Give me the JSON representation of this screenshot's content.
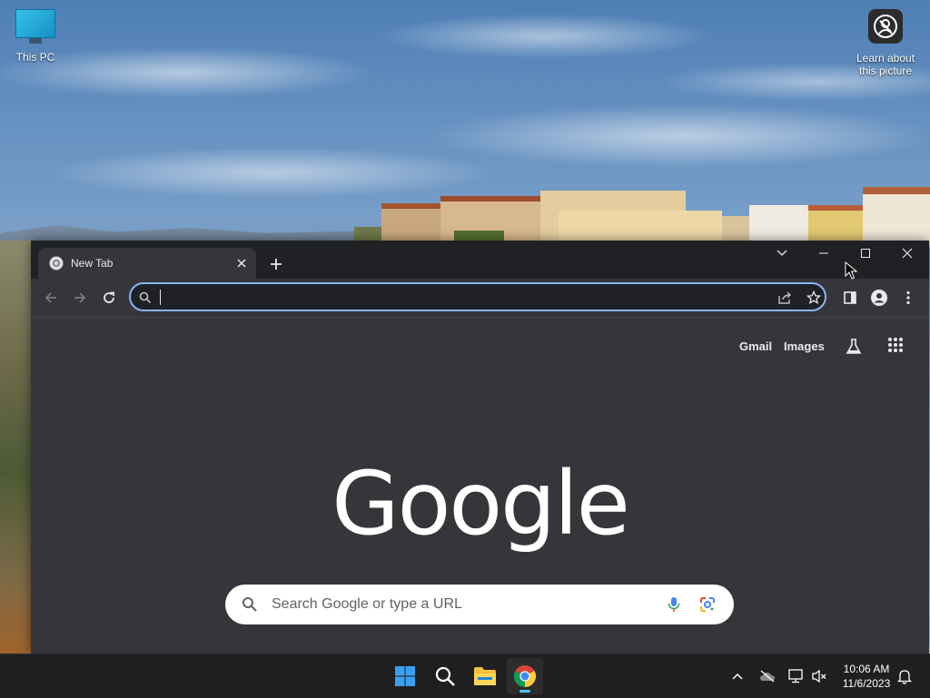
{
  "desktop": {
    "icons": [
      {
        "label": "This PC",
        "icon": "monitor-icon"
      },
      {
        "label": "Learn about this picture",
        "icon": "camera-info-icon"
      }
    ]
  },
  "browser": {
    "tab": {
      "title": "New Tab",
      "favicon": "chrome-icon"
    },
    "window_controls": {
      "dropdown": "chevron-down-icon",
      "minimize": "minimize-icon",
      "maximize": "maximize-icon",
      "close": "close-icon"
    },
    "omnibox": {
      "value": "",
      "placeholder": ""
    },
    "toolbar_icons": [
      "back-arrow-icon",
      "forward-arrow-icon",
      "reload-icon",
      "share-icon",
      "star-icon",
      "side-panel-icon",
      "profile-icon",
      "more-vert-icon"
    ]
  },
  "newtab_page": {
    "links": {
      "gmail": "Gmail",
      "images": "Images"
    },
    "logo": "Google",
    "search": {
      "placeholder": "Search Google or type a URL"
    },
    "colors": {
      "background": "#35363a",
      "search_box": "#ffffff",
      "omnibox_border": "#8ab4f8"
    }
  },
  "taskbar": {
    "pinned": [
      "windows-start-icon",
      "search-icon",
      "file-explorer-icon",
      "chrome-icon"
    ],
    "active": "chrome-icon",
    "clock": {
      "time": "10:06 AM",
      "date": "11/6/2023"
    },
    "tray_icons": [
      "chevron-up-icon",
      "onedrive-icon",
      "network-icon",
      "volume-muted-icon",
      "notification-bell-icon"
    ]
  }
}
